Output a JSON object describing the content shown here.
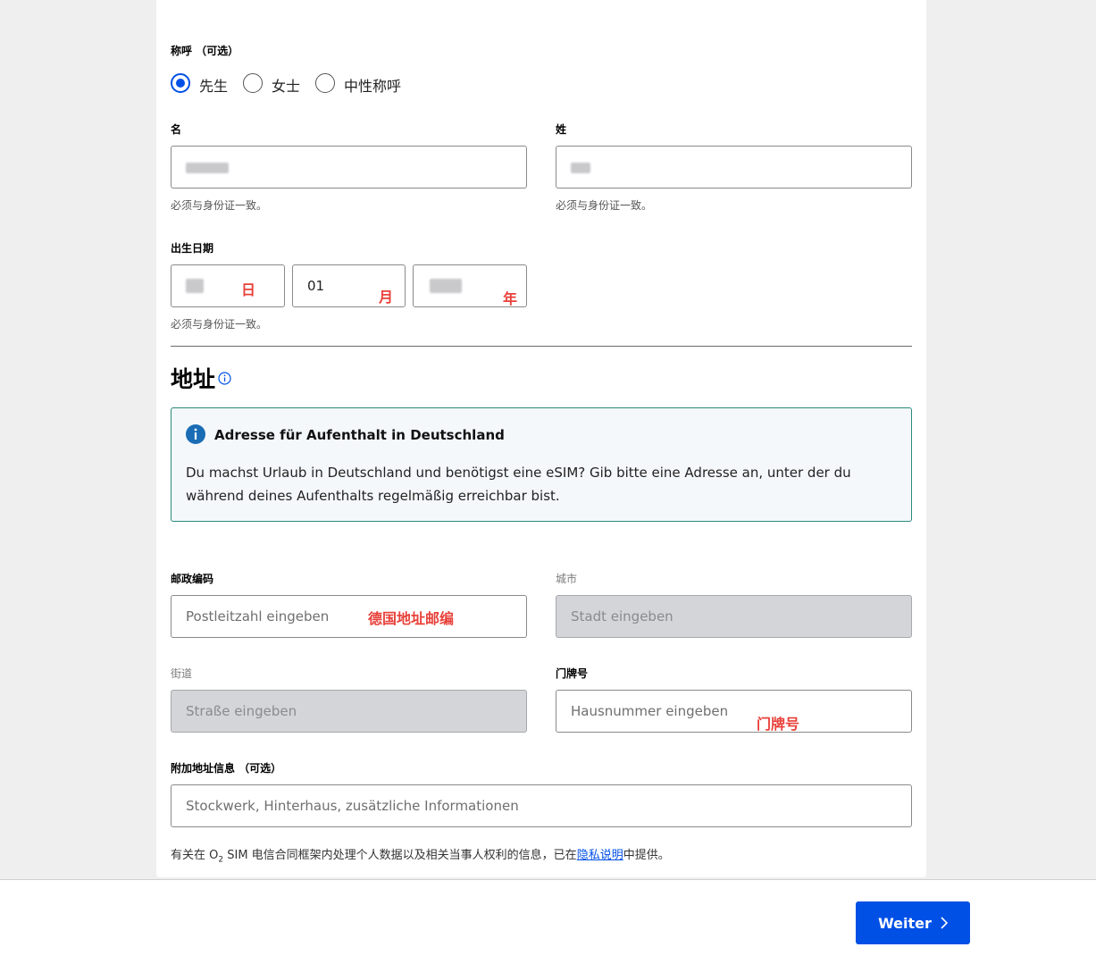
{
  "salutation": {
    "label": "称呼 （可选）",
    "options": [
      {
        "label": "先生",
        "checked": true
      },
      {
        "label": "女士",
        "checked": false
      },
      {
        "label": "中性称呼",
        "checked": false
      }
    ]
  },
  "first_name": {
    "label": "名",
    "hint": "必须与身份证一致。"
  },
  "last_name": {
    "label": "姓",
    "hint": "必须与身份证一致。"
  },
  "birthdate": {
    "label": "出生日期",
    "day_annotation": "日",
    "month_value": "01",
    "month_annotation": "月",
    "year_annotation": "年",
    "hint": "必须与身份证一致。"
  },
  "address": {
    "title": "地址",
    "info_box": {
      "title": "Adresse für Aufenthalt in Deutschland",
      "body": "Du machst Urlaub in Deutschland und benötigst eine eSIM? Gib bitte eine Adresse an, unter der du während deines Aufenthalts regelmäßig erreichbar bist."
    },
    "postcode": {
      "label": "邮政编码",
      "placeholder": "Postleitzahl eingeben",
      "annotation": "德国地址邮编"
    },
    "city": {
      "label": "城市",
      "placeholder": "Stadt eingeben"
    },
    "street": {
      "label": "街道",
      "placeholder": "Straße eingeben"
    },
    "house_number": {
      "label": "门牌号",
      "placeholder": "Hausnummer eingeben",
      "annotation": "门牌号"
    },
    "additional": {
      "label": "附加地址信息 （可选）",
      "placeholder": "Stockwerk, Hinterhaus, zusätzliche Informationen"
    }
  },
  "privacy": {
    "prefix": "有关在 O",
    "sub": "2",
    "middle": " SIM 电信合同框架内处理个人数据以及相关当事人权利的信息，已在",
    "link": "隐私说明",
    "suffix": "中提供。"
  },
  "footer": {
    "next_button": "Weiter"
  },
  "colors": {
    "accent": "#0050e6",
    "annotation": "#e8413a",
    "info_border": "#2b8a7c"
  }
}
